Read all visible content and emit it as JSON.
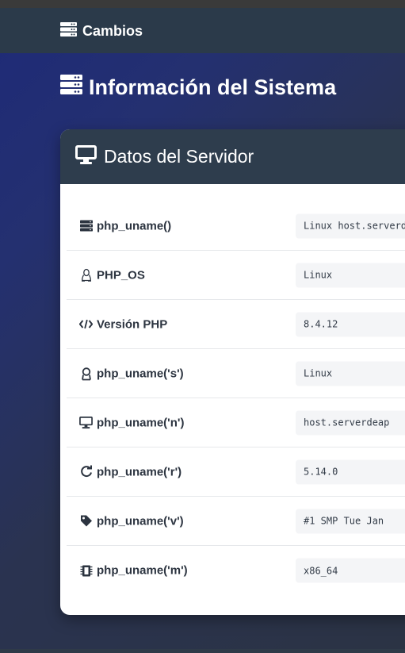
{
  "navbar": {
    "brand_label": "Cambios",
    "brand_icon": "server-icon"
  },
  "page": {
    "title": "Información del Sistema",
    "title_icon": "server-icon"
  },
  "card": {
    "title": "Datos del Servidor",
    "title_icon": "desktop-icon",
    "rows": [
      {
        "label": "php_uname()",
        "icon": "server-icon",
        "value": "Linux host.serverdeap"
      },
      {
        "label": "PHP_OS",
        "icon": "linux-icon",
        "value": "Linux"
      },
      {
        "label": "Versión PHP",
        "icon": "code-icon",
        "value": "8.4.12"
      },
      {
        "label": "php_uname('s')",
        "icon": "user-icon",
        "value": "Linux"
      },
      {
        "label": "php_uname('n')",
        "icon": "desktop-icon",
        "value": "host.serverdeap"
      },
      {
        "label": "php_uname('r')",
        "icon": "refresh-icon",
        "value": "5.14.0"
      },
      {
        "label": "php_uname('v')",
        "icon": "tag-icon",
        "value": "#1 SMP Tue Jan"
      },
      {
        "label": "php_uname('m')",
        "icon": "memory-icon",
        "value": "x86_64"
      }
    ]
  },
  "colors": {
    "navbar": "#2b3a4a",
    "card_header": "#2e3d4d",
    "label_text": "#2c3440",
    "value_bg": "#f4f5f7"
  }
}
